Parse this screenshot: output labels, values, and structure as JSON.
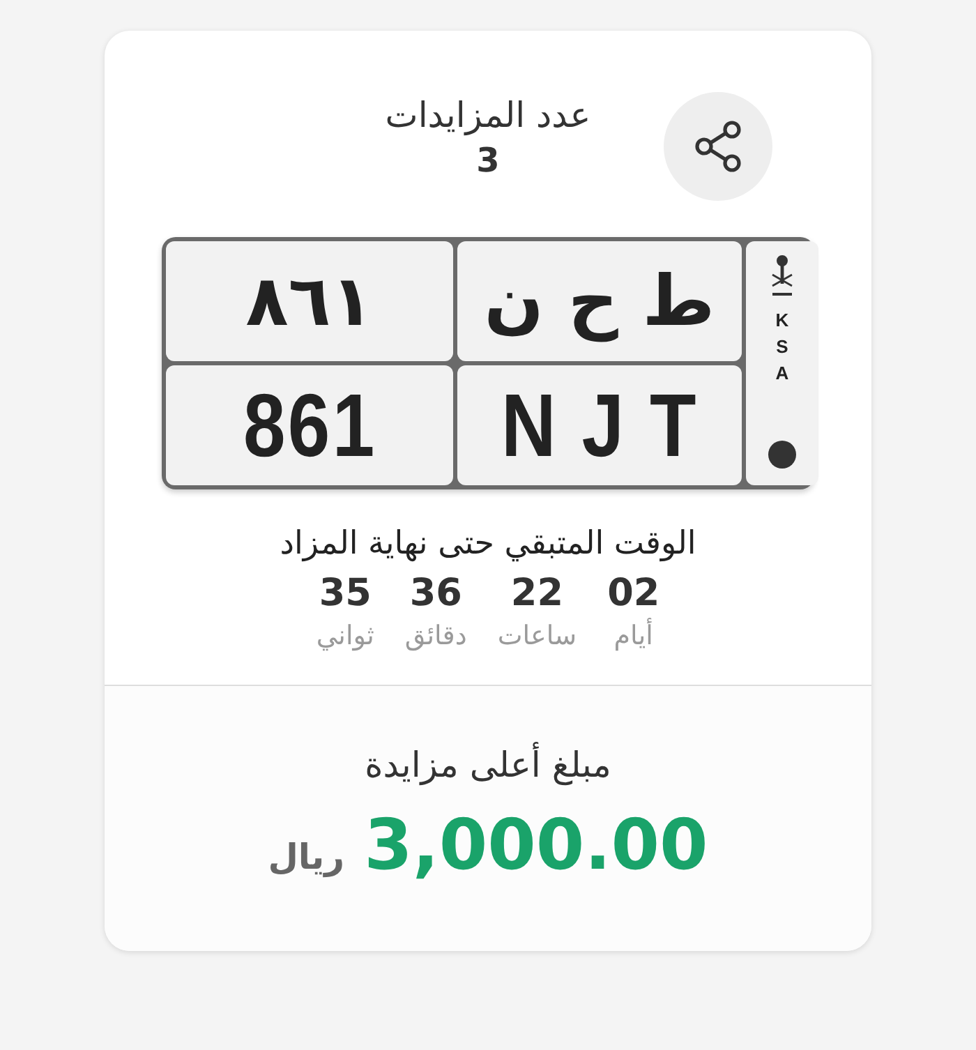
{
  "bids": {
    "label": "عدد المزايدات",
    "count": "3"
  },
  "plate": {
    "arabic_numbers": "٨٦١",
    "arabic_letters": "ط ح ن",
    "latin_numbers": "861",
    "latin_letters": "N J T",
    "country": [
      "K",
      "S",
      "A"
    ]
  },
  "countdown": {
    "title": "الوقت المتبقي حتى نهاية المزاد",
    "units": [
      {
        "value": "02",
        "label": "أيام"
      },
      {
        "value": "22",
        "label": "ساعات"
      },
      {
        "value": "36",
        "label": "دقائق"
      },
      {
        "value": "35",
        "label": "ثواني"
      }
    ]
  },
  "highest_bid": {
    "label": "مبلغ أعلى مزايدة",
    "amount": "3,000.00",
    "currency": "ريال"
  }
}
